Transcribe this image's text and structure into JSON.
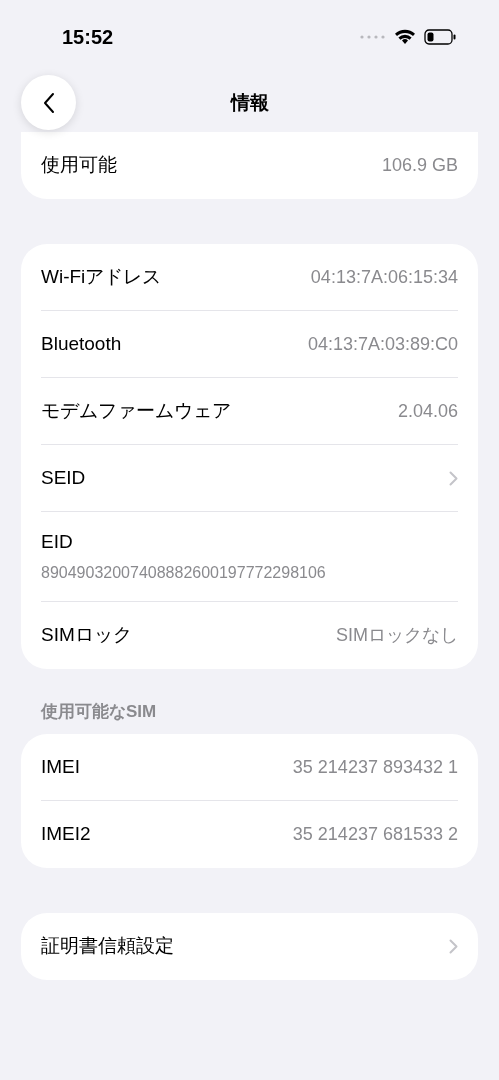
{
  "status_bar": {
    "time": "15:52"
  },
  "nav": {
    "title": "情報"
  },
  "groups": [
    {
      "rows": [
        {
          "kind": "value",
          "label": "使用可能",
          "value": "106.9 GB"
        }
      ]
    },
    {
      "rows": [
        {
          "kind": "value",
          "label": "Wi-Fiアドレス",
          "value": "04:13:7A:06:15:34"
        },
        {
          "kind": "value",
          "label": "Bluetooth",
          "value": "04:13:7A:03:89:C0"
        },
        {
          "kind": "value",
          "label": "モデムファームウェア",
          "value": "2.04.06"
        },
        {
          "kind": "chevron",
          "label": "SEID"
        },
        {
          "kind": "stacked",
          "label": "EID",
          "value": "89049032007408882600197772298106"
        },
        {
          "kind": "value",
          "label": "SIMロック",
          "value": "SIMロックなし"
        }
      ]
    },
    {
      "header": "使用可能なSIM",
      "rows": [
        {
          "kind": "value",
          "label": "IMEI",
          "value": "35 214237 893432 1"
        },
        {
          "kind": "value",
          "label": "IMEI2",
          "value": "35 214237 681533 2"
        }
      ]
    },
    {
      "rows": [
        {
          "kind": "chevron",
          "label": "証明書信頼設定"
        }
      ]
    }
  ]
}
